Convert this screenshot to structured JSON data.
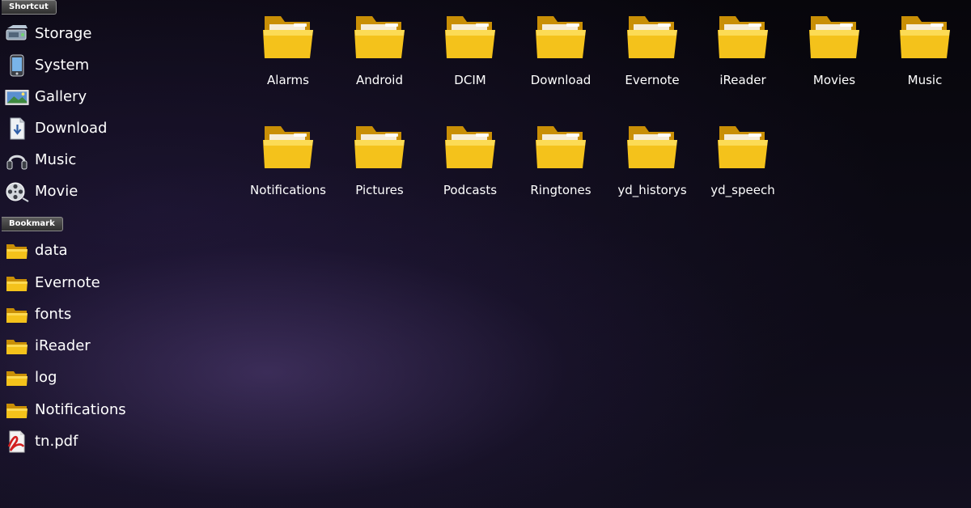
{
  "sidebar": {
    "shortcut_header": "Shortcut",
    "shortcuts": [
      {
        "label": "Storage",
        "icon": "storage-icon"
      },
      {
        "label": "System",
        "icon": "phone-icon"
      },
      {
        "label": "Gallery",
        "icon": "gallery-icon"
      },
      {
        "label": "Download",
        "icon": "download-icon"
      },
      {
        "label": "Music",
        "icon": "headphones-icon"
      },
      {
        "label": "Movie",
        "icon": "film-reel-icon"
      }
    ],
    "bookmark_header": "Bookmark",
    "bookmarks": [
      {
        "label": "data",
        "icon": "folder-icon"
      },
      {
        "label": "Evernote",
        "icon": "folder-icon"
      },
      {
        "label": "fonts",
        "icon": "folder-icon"
      },
      {
        "label": "iReader",
        "icon": "folder-icon"
      },
      {
        "label": "log",
        "icon": "folder-icon"
      },
      {
        "label": "Notifications",
        "icon": "folder-icon"
      },
      {
        "label": "tn.pdf",
        "icon": "pdf-icon"
      }
    ]
  },
  "folders": [
    {
      "name": "Alarms"
    },
    {
      "name": "Android"
    },
    {
      "name": "DCIM"
    },
    {
      "name": "Download"
    },
    {
      "name": "Evernote"
    },
    {
      "name": "iReader"
    },
    {
      "name": "Movies"
    },
    {
      "name": "Music"
    },
    {
      "name": "Notifications"
    },
    {
      "name": "Pictures"
    },
    {
      "name": "Podcasts"
    },
    {
      "name": "Ringtones"
    },
    {
      "name": "yd_historys"
    },
    {
      "name": "yd_speech"
    }
  ],
  "colors": {
    "folder_body": "#f4c21b",
    "folder_light": "#ffe36a",
    "folder_dark": "#c98f06",
    "background": "#0d0b16",
    "text": "#ffffff"
  }
}
